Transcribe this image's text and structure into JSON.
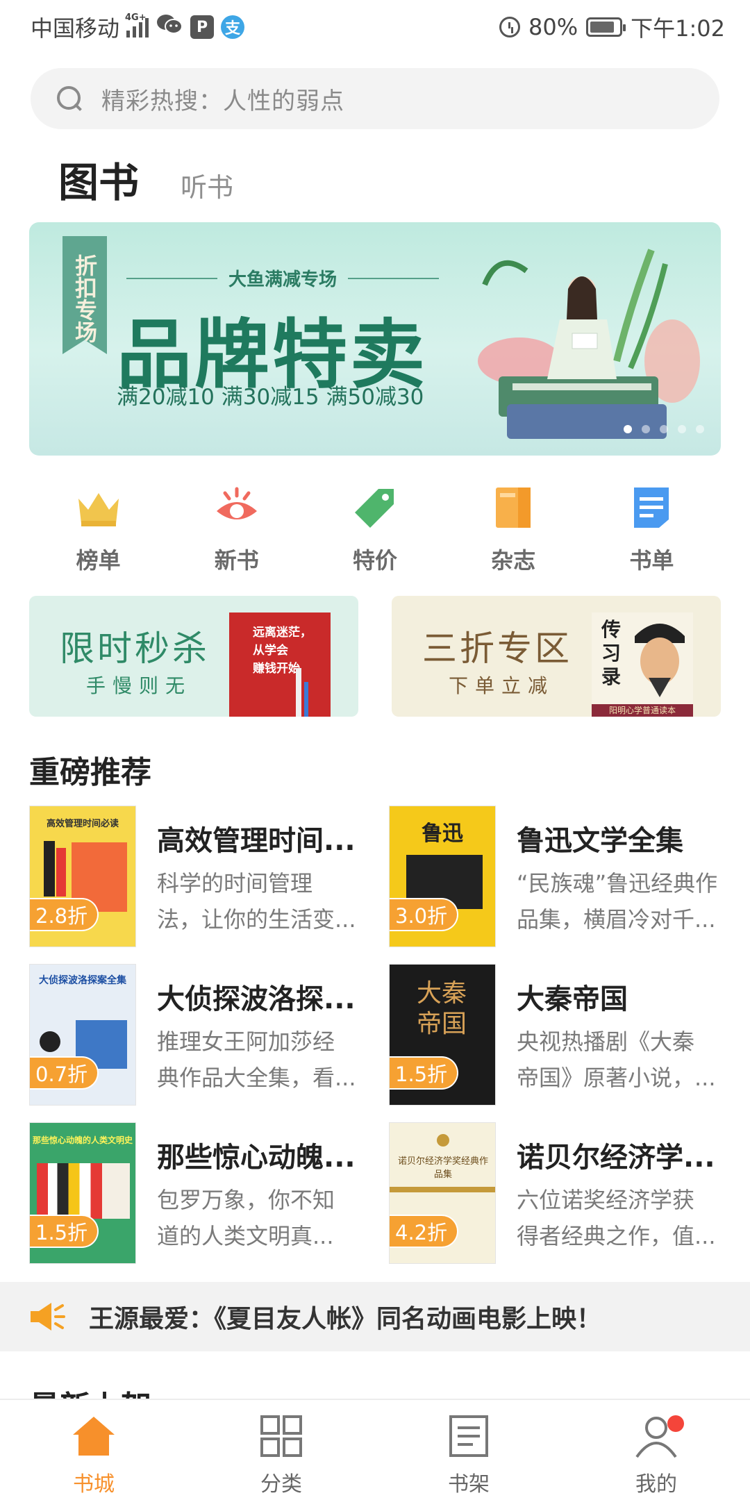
{
  "status_bar": {
    "carrier": "中国移动",
    "network": "4G+",
    "battery": "80%",
    "time": "下午1:02",
    "app_icons": [
      "wechat-icon",
      "p-app-icon",
      "alipay-icon"
    ],
    "app_icon_letters": [
      "P",
      "支"
    ]
  },
  "search": {
    "placeholder": "精彩热搜：人性的弱点"
  },
  "tabs": [
    {
      "label": "图书",
      "active": true
    },
    {
      "label": "听书",
      "active": false
    }
  ],
  "banner": {
    "ribbon": "折扣专场",
    "subtitle": "大鱼满减专场",
    "title": "品牌特卖",
    "offer": "满20减10 满30减15 满50减30",
    "dot_count": 5,
    "active_dot": 0
  },
  "categories": [
    {
      "label": "榜单",
      "icon": "crown-icon",
      "color": "#f1c54d"
    },
    {
      "label": "新书",
      "icon": "eye-icon",
      "color": "#f06a5e"
    },
    {
      "label": "特价",
      "icon": "tag-icon",
      "color": "#4fb56c"
    },
    {
      "label": "杂志",
      "icon": "magazine-icon",
      "color": "#f8b04a"
    },
    {
      "label": "书单",
      "icon": "list-doc-icon",
      "color": "#4a9af0"
    }
  ],
  "promos": {
    "left": {
      "title": "限时秒杀",
      "subtitle": "手慢则无",
      "cover_text": [
        "远离迷茫，",
        "从学会",
        "赚钱开始"
      ]
    },
    "right": {
      "title": "三折专区",
      "subtitle": "下单立减",
      "cover_text": [
        "传",
        "习",
        "录"
      ],
      "cover_footer": "阳明心学普通读本"
    }
  },
  "section_title": "重磅推荐",
  "books": [
    {
      "title": "高效管理时间...",
      "desc": [
        "科学的时间管理",
        "法，让你的生活变..."
      ],
      "discount": "2.8折",
      "cover_text": "高效管理时间必读",
      "cover_bg": "#f7d84c"
    },
    {
      "title": "鲁迅文学全集",
      "desc": [
        "“民族魂”鲁迅经典作",
        "品集，横眉冷对千..."
      ],
      "discount": "3.0折",
      "cover_text": "鲁迅",
      "cover_bg": "#f5c91a"
    },
    {
      "title": "大侦探波洛探...",
      "desc": [
        "推理女王阿加莎经",
        "典作品大全集，看..."
      ],
      "discount": "0.7折",
      "cover_text": "大侦探波洛探案全集",
      "cover_bg": "#e7eef6"
    },
    {
      "title": "大秦帝国",
      "desc": [
        "央视热播剧《大秦",
        "帝国》原著小说，..."
      ],
      "discount": "1.5折",
      "cover_text": "大秦帝国",
      "cover_bg": "#1b1b1b"
    },
    {
      "title": "那些惊心动魄...",
      "desc": [
        "包罗万象，你不知",
        "道的人类文明真..."
      ],
      "discount": "1.5折",
      "cover_text": "那些惊心动魄的人类文明史",
      "cover_bg": "#3aa56a"
    },
    {
      "title": "诺贝尔经济学...",
      "desc": [
        "六位诺奖经济学获",
        "得者经典之作，值..."
      ],
      "discount": "4.2折",
      "cover_text": "诺贝尔经济学奖经典作品集",
      "cover_bg": "#f6f1dc"
    }
  ],
  "notice": {
    "text": "王源最爱：《夏目友人帐》同名动画电影上映！"
  },
  "next_section_title": "最新上架",
  "bottom_nav": [
    {
      "label": "书城",
      "icon": "home-icon",
      "active": true
    },
    {
      "label": "分类",
      "icon": "grid-icon",
      "active": false
    },
    {
      "label": "书架",
      "icon": "bookshelf-icon",
      "active": false
    },
    {
      "label": "我的",
      "icon": "user-icon",
      "active": false,
      "badge": true
    }
  ],
  "colors": {
    "accent": "#f7902b",
    "discount": "#f6a132",
    "badge": "#f4453a"
  }
}
